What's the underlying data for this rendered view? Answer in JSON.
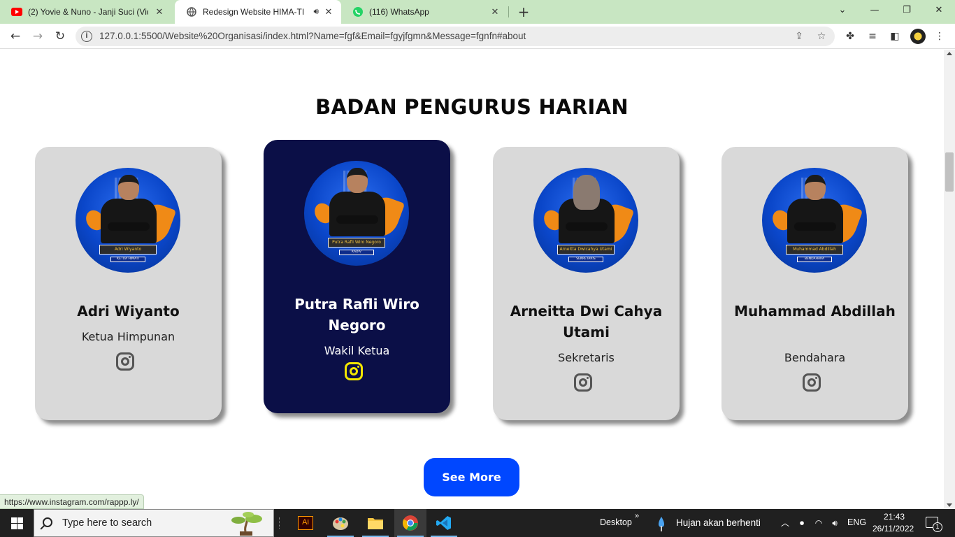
{
  "browser": {
    "tabs": [
      {
        "title": "(2) Yovie & Nuno - Janji Suci (Vid",
        "icon": "youtube-icon"
      },
      {
        "title": "Redesign Website HIMA-TI",
        "icon": "globe-icon"
      },
      {
        "title": "(116) WhatsApp",
        "icon": "whatsapp-icon"
      }
    ],
    "url": "127.0.0.1:5500/Website%20Organisasi/index.html?Name=fgf&Email=fgyjfgmn&Message=fgnfn#about"
  },
  "page": {
    "section_title": "BADAN PENGURUS HARIAN",
    "members": [
      {
        "name": "Adri Wiyanto",
        "role": "Ketua Himpunan",
        "photo_caption": "Adri Wiyanto",
        "photo_role": "KETUA HIMATI"
      },
      {
        "name": "Putra Rafli Wiro Negoro",
        "role": "Wakil Ketua",
        "photo_caption": "Putra Rafli Wiro Negoro",
        "photo_role": "KADIV"
      },
      {
        "name": "Arneitta Dwi Cahya Utami",
        "role": "Sekretaris",
        "photo_caption": "Arneitta Dwicahya Utami",
        "photo_role": "SEKRETARIS"
      },
      {
        "name": "Muhammad Abdillah",
        "role": "Bendahara",
        "photo_caption": "Muhammad Abdillah",
        "photo_role": "BENDAHARA"
      }
    ],
    "see_more_label": "See More",
    "status_url": "https://www.instagram.com/rappp.ly/",
    "colors": {
      "card": "#d9d9d9",
      "featured_card": "#0b0f47",
      "button": "#0047ff",
      "featured_icon": "#f2e600"
    }
  },
  "taskbar": {
    "search_placeholder": "Type here to search",
    "desktop_label": "Desktop",
    "weather": "Hujan akan berhenti",
    "language": "ENG",
    "time": "21:43",
    "date": "26/11/2022",
    "notification_count": "1"
  }
}
